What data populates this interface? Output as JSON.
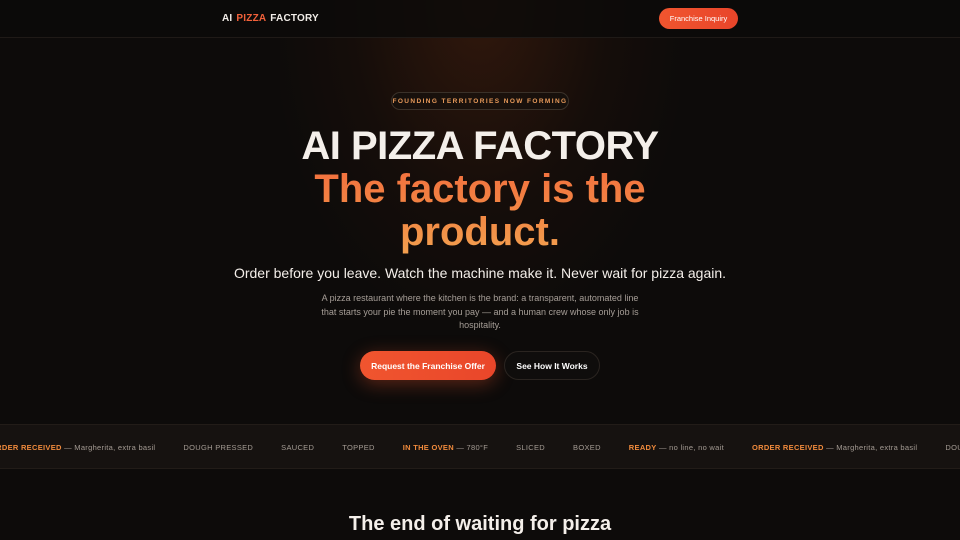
{
  "nav": {
    "logo_part1": "AI",
    "logo_accent": "PIZZA",
    "logo_part2": "FACTORY",
    "cta_label": "Franchise Inquiry"
  },
  "hero": {
    "badge": "FOUNDING TERRITORIES NOW FORMING",
    "title": "AI PIZZA FACTORY",
    "subtitle_line1": "The factory is the",
    "subtitle_line2": "product.",
    "tagline": "Order before you leave. Watch the machine make it. Never wait for pizza again.",
    "description": "A pizza restaurant where the kitchen is the brand: a transparent, automated line that starts your pie the moment you pay — and a human crew whose only job is hospitality.",
    "primary_button": "Request the Franchise Offer",
    "secondary_button": "See How It Works"
  },
  "ticker": {
    "items": [
      {
        "highlight": "ORDER RECEIVED",
        "rest": " — Margherita, extra basil"
      },
      {
        "highlight": "",
        "rest": "DOUGH PRESSED"
      },
      {
        "highlight": "",
        "rest": "SAUCED"
      },
      {
        "highlight": "",
        "rest": "TOPPED"
      },
      {
        "highlight": "IN THE OVEN",
        "rest": " — 780°F"
      },
      {
        "highlight": "",
        "rest": "SLICED"
      },
      {
        "highlight": "",
        "rest": "BOXED"
      },
      {
        "highlight": "READY",
        "rest": " — no line, no wait"
      },
      {
        "highlight": "ORDER RECEIVED",
        "rest": " — Margherita, extra basil"
      },
      {
        "highlight": "",
        "rest": "DOUGH PRESSED"
      }
    ]
  },
  "section": {
    "title": "The end of waiting for pizza"
  },
  "colors": {
    "accent": "#f0552f",
    "highlight": "#f08a3c",
    "background": "#0d0b0a"
  }
}
